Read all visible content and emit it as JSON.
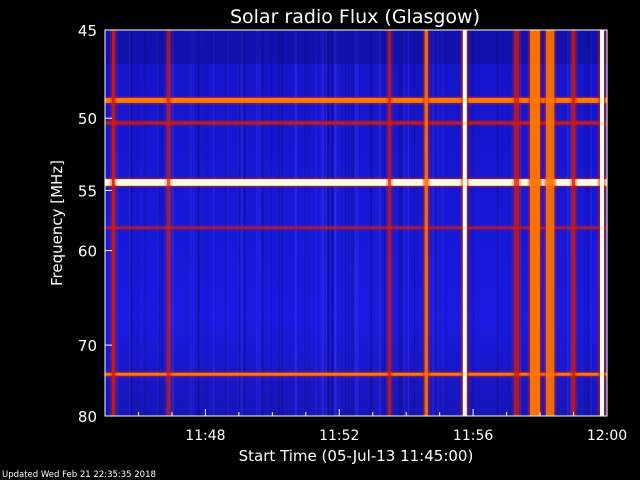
{
  "chart_data": {
    "type": "heatmap",
    "title": "Solar radio Flux (Glasgow)",
    "xlabel": "Start Time (05-Jul-13 11:45:00)",
    "ylabel": "Frequency [MHz]",
    "x_ticks": [
      "11:48",
      "11:52",
      "11:56",
      "12:00"
    ],
    "x_tick_minutes": [
      3,
      7,
      11,
      15
    ],
    "xlim_minutes": [
      0,
      15
    ],
    "y_ticks": [
      45,
      50,
      55,
      60,
      70,
      80
    ],
    "ylim": [
      45,
      80
    ],
    "y_scale": "reciprocal",
    "footer": "Updated Wed Feb 21 22:35:35 2018",
    "colors": {
      "background": "#1a1ad8",
      "dark": "#0c0c7a",
      "red": "#d21a0a",
      "hot": "#ff7a00",
      "white": "#ffffe0"
    },
    "horizontal_bands_mhz": [
      {
        "f": 48.9,
        "level": 0.85,
        "width": 0.3
      },
      {
        "f": 50.3,
        "level": 0.45,
        "width": 0.2
      },
      {
        "f": 54.4,
        "level": 1.0,
        "width": 0.5
      },
      {
        "f": 58.0,
        "level": 0.35,
        "width": 0.2
      },
      {
        "f": 73.8,
        "level": 0.9,
        "width": 0.4
      }
    ],
    "vertical_bursts_minutes": [
      {
        "t": 0.25,
        "level": 0.75,
        "width": 0.08
      },
      {
        "t": 1.9,
        "level": 0.45,
        "width": 0.1
      },
      {
        "t": 8.5,
        "level": 0.6,
        "width": 0.08
      },
      {
        "t": 9.6,
        "level": 0.8,
        "width": 0.1
      },
      {
        "t": 10.75,
        "level": 1.0,
        "width": 0.12
      },
      {
        "t": 12.3,
        "level": 0.55,
        "width": 0.15
      },
      {
        "t": 12.85,
        "level": 0.9,
        "width": 0.3
      },
      {
        "t": 13.3,
        "level": 0.8,
        "width": 0.25
      },
      {
        "t": 14.0,
        "level": 0.65,
        "width": 0.1
      },
      {
        "t": 14.85,
        "level": 1.0,
        "width": 0.12
      }
    ]
  }
}
